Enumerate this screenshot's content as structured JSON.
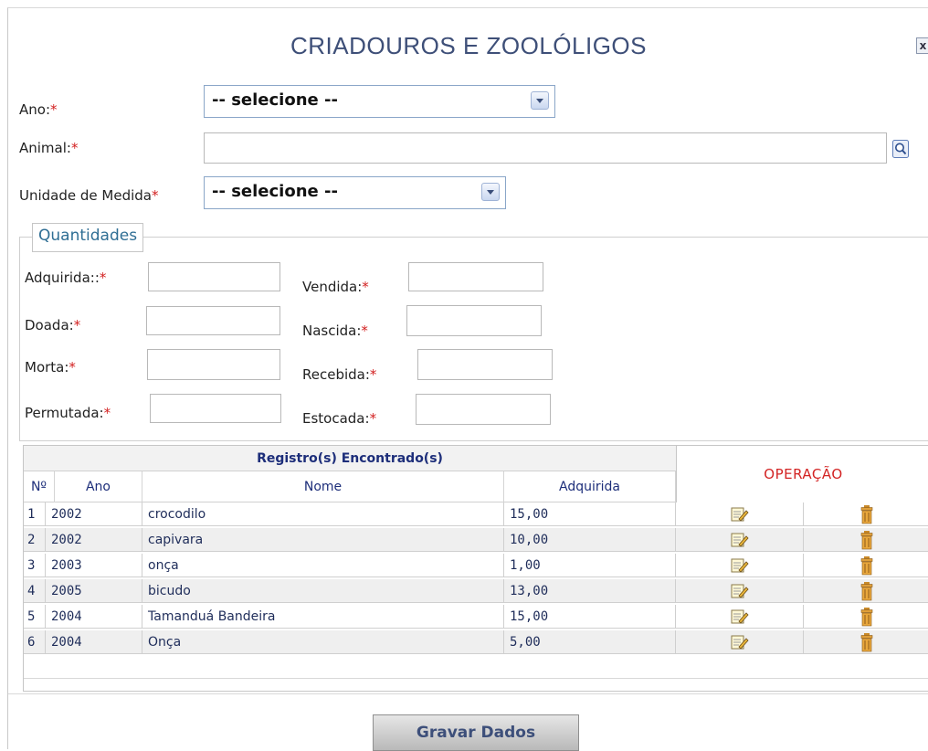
{
  "window": {
    "title": "CRIADOUROS E ZOOLÓLIGOS",
    "close_label": "x"
  },
  "form": {
    "ano_label": "Ano:",
    "ano_value": "-- selecione --",
    "animal_label": "Animal:",
    "animal_value": "",
    "unidade_label": "Unidade de Medida",
    "unidade_value": "-- selecione --",
    "required_mark": "*"
  },
  "quantidades": {
    "legend": "Quantidades",
    "fields": [
      {
        "label": "Adquirida::",
        "value": ""
      },
      {
        "label": "Doada:",
        "value": ""
      },
      {
        "label": "Morta:",
        "value": ""
      },
      {
        "label": "Permutada:",
        "value": ""
      },
      {
        "label": "Vendida:",
        "value": ""
      },
      {
        "label": "Nascida:",
        "value": ""
      },
      {
        "label": "Recebida:",
        "value": ""
      },
      {
        "label": "Estocada:",
        "value": ""
      }
    ]
  },
  "table": {
    "title": "Registro(s) Encontrado(s)",
    "operation_header": "OPERAÇÃO",
    "columns": [
      "Nº",
      "Ano",
      "Nome",
      "Adquirida"
    ],
    "rows": [
      {
        "n": "1",
        "ano": "2002",
        "nome": "crocodilo",
        "adquirida": "15,00"
      },
      {
        "n": "2",
        "ano": "2002",
        "nome": "capivara",
        "adquirida": "10,00"
      },
      {
        "n": "3",
        "ano": "2003",
        "nome": "onça",
        "adquirida": "1,00"
      },
      {
        "n": "4",
        "ano": "2005",
        "nome": "bicudo",
        "adquirida": "13,00"
      },
      {
        "n": "5",
        "ano": "2004",
        "nome": "Tamanduá Bandeira",
        "adquirida": "15,00"
      },
      {
        "n": "6",
        "ano": "2004",
        "nome": "Onça",
        "adquirida": "5,00"
      }
    ]
  },
  "actions": {
    "submit_label": "Gravar Dados"
  },
  "icons": {
    "edit": "edit-icon",
    "delete": "trash-icon",
    "search": "search-icon",
    "close": "close-icon"
  },
  "colors": {
    "title": "#3e4f78",
    "required": "#d21f1f",
    "table_header_text": "#1d2e7a",
    "operation_header": "#d32424"
  }
}
